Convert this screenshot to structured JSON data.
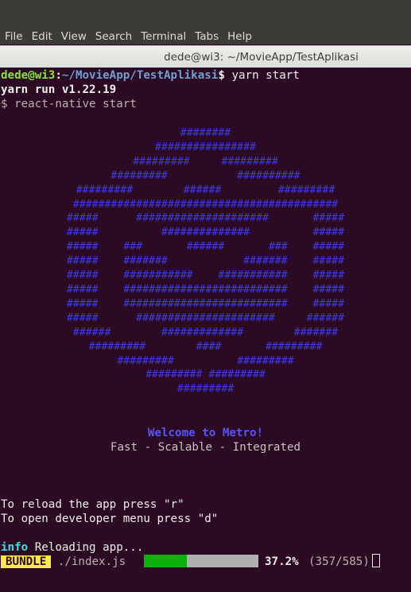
{
  "menu": {
    "items": [
      "File",
      "Edit",
      "View",
      "Search",
      "Terminal",
      "Tabs",
      "Help"
    ]
  },
  "window": {
    "title": "dede@wi3: ~/MovieApp/TestAplikasi"
  },
  "terminal": {
    "prompt": {
      "user_host": "dede@wi3",
      "sep": ":",
      "path": "~/MovieApp/TestAplikasi",
      "dollar": "$",
      "command": " yarn start"
    },
    "yarn_line": "yarn run v1.22.19",
    "react_cmd": "$ react-native start",
    "logo_art": "########\n################\n#########     #########\n#########           ##########\n#########        ######         #########\n##########################################\n#####      #####################       #####\n#####          ##############          #####\n#####    ###       ######       ###    #####\n#####    #######            #######    #####\n#####    ###########    ###########    #####\n#####    ##########################    #####\n#####    ##########################    #####\n#####      ######################     ######\n######        #############        #######\n#########        ####       #########\n#########          #########\n######### #########\n#########",
    "welcome_title": "Welcome to Metro!",
    "welcome_sub": "Fast - Scalable - Integrated",
    "reload_hint": "To reload the app press \"r\"",
    "devmenu_hint": "To open developer menu press \"d\"",
    "info_label": "info",
    "info_text": " Reloading app...",
    "bundle_label": "BUNDLE",
    "bundle_file": "./index.js",
    "progress_text": "37.2%",
    "progress_count": "(357/585)",
    "progress_fraction": 0.372
  },
  "colors": {
    "background": "#2c0a23",
    "prompt_user": "#8ae234",
    "prompt_path": "#729fcf",
    "logo": "#3c3ce8",
    "bundle_badge": "#fce94f",
    "progress_fill": "#0cb00c"
  }
}
